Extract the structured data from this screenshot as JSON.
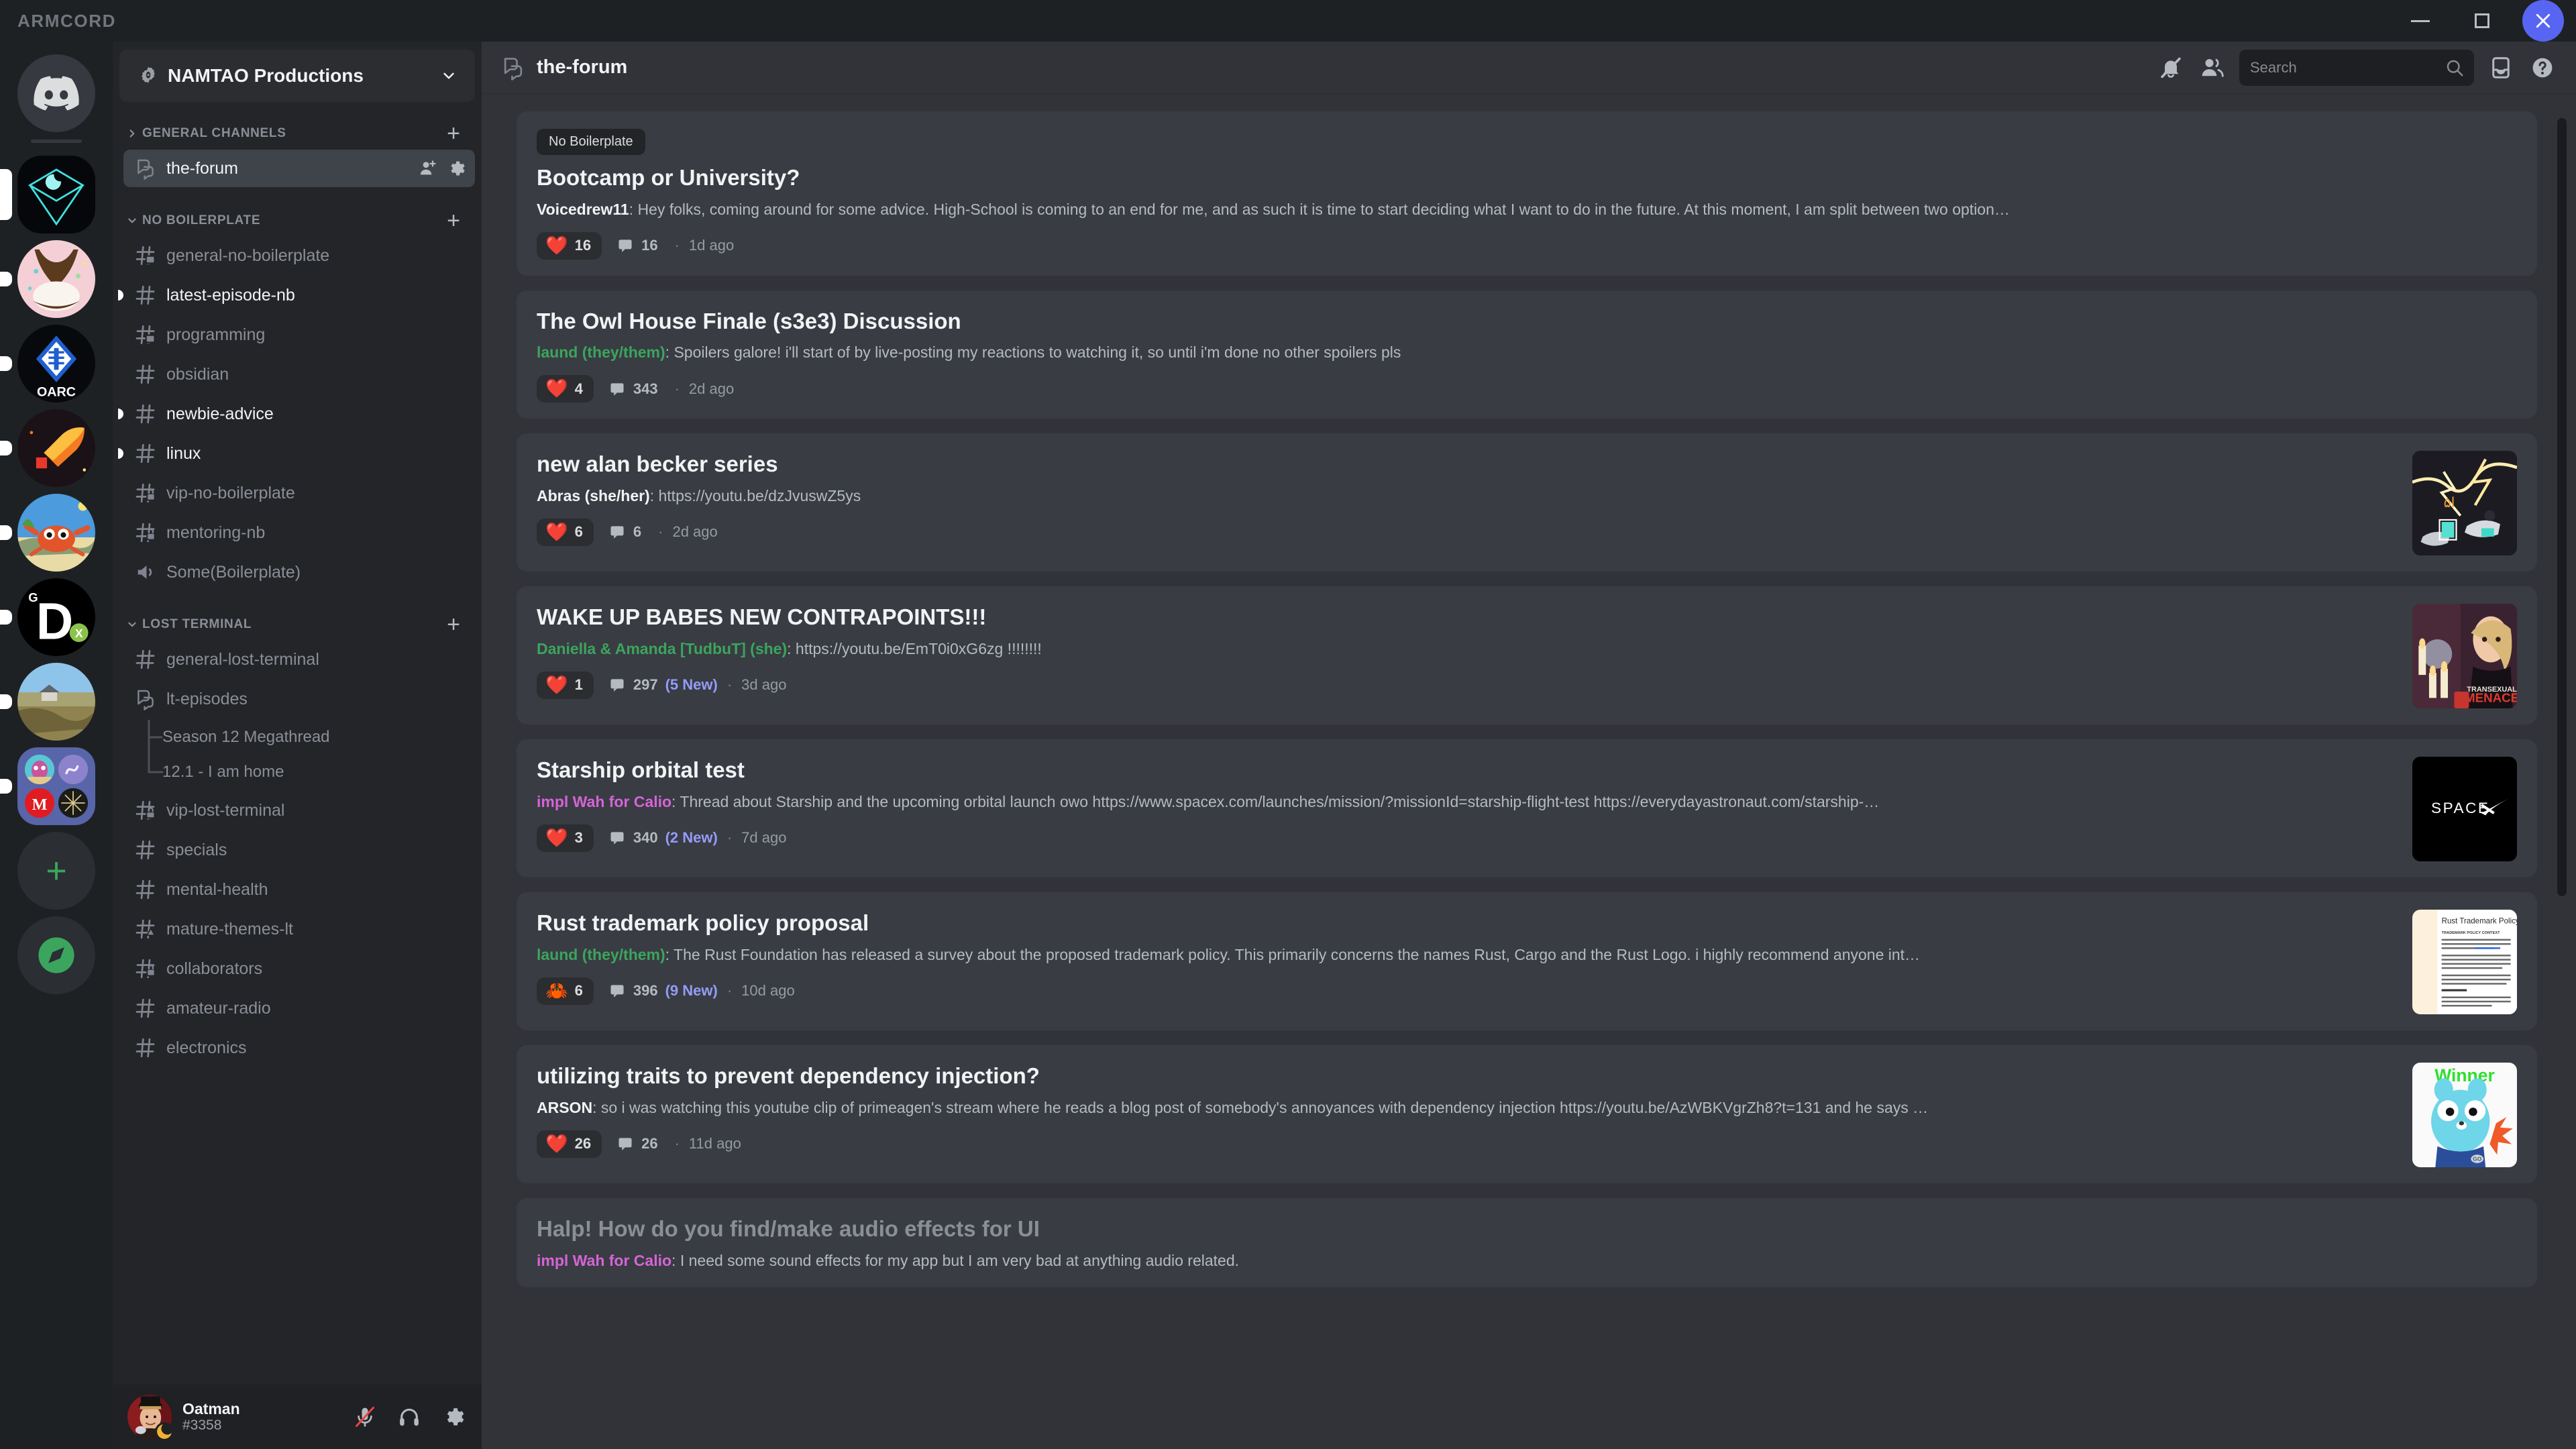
{
  "window": {
    "app_name": "ARMCORD",
    "minimize_label": "Minimize",
    "maximize_label": "Maximize",
    "close_label": "Close"
  },
  "server_rail": {
    "items": [
      {
        "name": "Direct Messages",
        "icon": "discord-logo",
        "unread": "none"
      },
      {
        "name": "Neon Cube Server",
        "icon": "neon-cube",
        "unread": "selected"
      },
      {
        "name": "Coffee Server",
        "icon": "coffee-cup",
        "unread": "dot"
      },
      {
        "name": "OARC",
        "icon": "oarc-diamond",
        "unread": "dot"
      },
      {
        "name": "Rocket Server",
        "icon": "rocket",
        "unread": "dot"
      },
      {
        "name": "Crab Server",
        "icon": "crab",
        "unread": "dot"
      },
      {
        "name": "GDX Server",
        "icon": "gdx-letter-d",
        "unread": "dot"
      },
      {
        "name": "Cottage Server",
        "icon": "cottage-landscape",
        "unread": "dot"
      },
      {
        "name": "Server Folder",
        "icon": "server-folder",
        "unread": "dot"
      },
      {
        "name": "Add a Server",
        "icon": "plus-icon",
        "unread": "none"
      },
      {
        "name": "Explore Public Servers",
        "icon": "compass-icon",
        "unread": "none"
      }
    ]
  },
  "sidebar": {
    "guild_name": "NAMTAO Productions",
    "categories": [
      {
        "label": "GENERAL CHANNELS",
        "collapsed": true,
        "add_label": "+",
        "channels": [
          {
            "name": "the-forum",
            "icon": "forum-icon",
            "state": "active",
            "actions": [
              "add-member-icon",
              "gear-icon"
            ]
          }
        ]
      },
      {
        "label": "NO BOILERPLATE",
        "collapsed": false,
        "add_label": "+",
        "channels": [
          {
            "name": "general-no-boilerplate",
            "icon": "hash-thread-icon",
            "state": "normal"
          },
          {
            "name": "latest-episode-nb",
            "icon": "hash-icon",
            "state": "unread"
          },
          {
            "name": "programming",
            "icon": "hash-thread-icon",
            "state": "normal"
          },
          {
            "name": "obsidian",
            "icon": "hash-icon",
            "state": "normal"
          },
          {
            "name": "newbie-advice",
            "icon": "hash-icon",
            "state": "unread"
          },
          {
            "name": "linux",
            "icon": "hash-icon",
            "state": "unread"
          },
          {
            "name": "vip-no-boilerplate",
            "icon": "hash-lock-icon",
            "state": "normal"
          },
          {
            "name": "mentoring-nb",
            "icon": "hash-lock-icon",
            "state": "normal"
          },
          {
            "name": "Some(Boilerplate)",
            "icon": "speaker-icon",
            "state": "normal"
          }
        ]
      },
      {
        "label": "LOST TERMINAL",
        "collapsed": false,
        "add_label": "+",
        "channels": [
          {
            "name": "general-lost-terminal",
            "icon": "hash-icon",
            "state": "normal"
          },
          {
            "name": "lt-episodes",
            "icon": "forum-icon",
            "state": "normal"
          },
          {
            "name": "Season 12 Megathread",
            "icon": "thread-branch",
            "state": "thread"
          },
          {
            "name": "12.1 - I am home",
            "icon": "thread-branch-end",
            "state": "thread"
          },
          {
            "name": "vip-lost-terminal",
            "icon": "hash-lock-thread-icon",
            "state": "normal"
          },
          {
            "name": "specials",
            "icon": "hash-icon",
            "state": "normal"
          },
          {
            "name": "mental-health",
            "icon": "hash-icon",
            "state": "normal"
          },
          {
            "name": "mature-themes-lt",
            "icon": "hash-nsfw-icon",
            "state": "normal"
          },
          {
            "name": "collaborators",
            "icon": "hash-lock-icon",
            "state": "normal"
          },
          {
            "name": "amateur-radio",
            "icon": "hash-icon",
            "state": "normal"
          },
          {
            "name": "electronics",
            "icon": "hash-icon",
            "state": "normal"
          }
        ]
      }
    ]
  },
  "user_panel": {
    "username": "Oatman",
    "discriminator": "#3358",
    "status": "idle",
    "mic_label": "Mute",
    "mic_muted": true,
    "headphones_label": "Deafen",
    "settings_label": "User Settings"
  },
  "channel_header": {
    "icon": "forum-icon",
    "title": "the-forum",
    "actions": [
      {
        "name": "notification-off-icon",
        "label": "Notification Settings"
      },
      {
        "name": "members-icon",
        "label": "Show Member List"
      }
    ],
    "trailing_actions": [
      {
        "name": "inbox-icon",
        "label": "Inbox"
      },
      {
        "name": "help-icon",
        "label": "Help"
      }
    ]
  },
  "search": {
    "placeholder": "Search",
    "value": "",
    "icon": "search-icon"
  },
  "forum": {
    "posts": [
      {
        "tags": [
          "No Boilerplate"
        ],
        "title": "Bootcamp or University?",
        "author": "Voicedrew11",
        "author_color": "#f2f3f5",
        "preview": "Hey folks, coming around for some advice. High-School is coming to an end for me, and as such it is time to start deciding what I want to do in the future. At this moment, I am split between two option…",
        "reaction_emoji": "❤️",
        "reaction_count": "16",
        "message_count": "16",
        "new_count": "",
        "time": "1d ago",
        "thumbnail": "none",
        "read": false
      },
      {
        "tags": [],
        "title": "The Owl House Finale (s3e3) Discussion",
        "author": "laund (they/them)",
        "author_color": "#3ba55d",
        "preview": "Spoilers galore! i'll start of by live-posting my reactions to watching it, so until i'm done no other spoilers pls",
        "reaction_emoji": "❤️",
        "reaction_count": "4",
        "message_count": "343",
        "new_count": "",
        "time": "2d ago",
        "thumbnail": "none",
        "read": false
      },
      {
        "tags": [],
        "title": "new alan becker series",
        "author": "Abras (she/her)",
        "author_color": "#f2f3f5",
        "preview": "https://youtu.be/dzJvuswZ5ys",
        "reaction_emoji": "❤️",
        "reaction_count": "6",
        "message_count": "6",
        "new_count": "",
        "time": "2d ago",
        "thumbnail": "lightning-scooters",
        "read": false
      },
      {
        "tags": [],
        "title": "WAKE UP BABES NEW CONTRAPOINTS!!!",
        "author": "Daniella & Amanda [TudbuT] (she)",
        "author_color": "#3ba55d",
        "preview": "https://youtu.be/EmT0i0xG6zg !!!!!!!!",
        "reaction_emoji": "❤️",
        "reaction_count": "1",
        "message_count": "297",
        "new_count": "(5 New)",
        "time": "3d ago",
        "thumbnail": "contrapoints-candles",
        "read": false
      },
      {
        "tags": [],
        "title": "Starship orbital test",
        "author": "impl Wah for Calio",
        "author_color": "#d664d6",
        "preview": "Thread about Starship and the upcoming orbital launch owo https://www.spacex.com/launches/mission/?missionId=starship-flight-test https://everydayastronaut.com/starship-…",
        "reaction_emoji": "❤️",
        "reaction_count": "3",
        "message_count": "340",
        "new_count": "(2 New)",
        "time": "7d ago",
        "thumbnail": "spacex-logo",
        "read": false
      },
      {
        "tags": [],
        "title": "Rust trademark policy proposal",
        "author": "laund (they/them)",
        "author_color": "#3ba55d",
        "preview": "The Rust Foundation has released a survey about the proposed trademark policy. This primarily concerns the names Rust, Cargo and the Rust Logo. i highly recommend anyone int…",
        "reaction_emoji": "🦀",
        "reaction_count": "6",
        "message_count": "396",
        "new_count": "(9 New)",
        "time": "10d ago",
        "thumbnail": "rust-trademark-doc",
        "read": false
      },
      {
        "tags": [],
        "title": "utilizing traits to prevent dependency injection?",
        "author": "ARSON",
        "author_color": "#f2f3f5",
        "preview": "so i was watching this youtube clip of primeagen's stream where he reads a blog post of somebody's annoyances with dependency injection https://youtu.be/AzWBKVgrZh8?t=131 and he says …",
        "reaction_emoji": "❤️",
        "reaction_count": "26",
        "message_count": "26",
        "new_count": "",
        "time": "11d ago",
        "thumbnail": "go-gopher-winner",
        "read": false
      },
      {
        "tags": [],
        "title": "Halp! How do you find/make audio effects for UI",
        "author": "impl Wah for Calio",
        "author_color": "#d664d6",
        "preview": "I need some sound effects for my app but I am very bad at anything audio related.",
        "reaction_emoji": "",
        "reaction_count": "",
        "message_count": "",
        "new_count": "",
        "time": "",
        "thumbnail": "none",
        "read": true
      }
    ]
  },
  "colors": {
    "accent": "#5865f2",
    "new_badge": "#949cf7",
    "green_name": "#3ba55d",
    "pink_name": "#d664d6",
    "idle": "#f0b232",
    "heart": "#ed4245"
  }
}
